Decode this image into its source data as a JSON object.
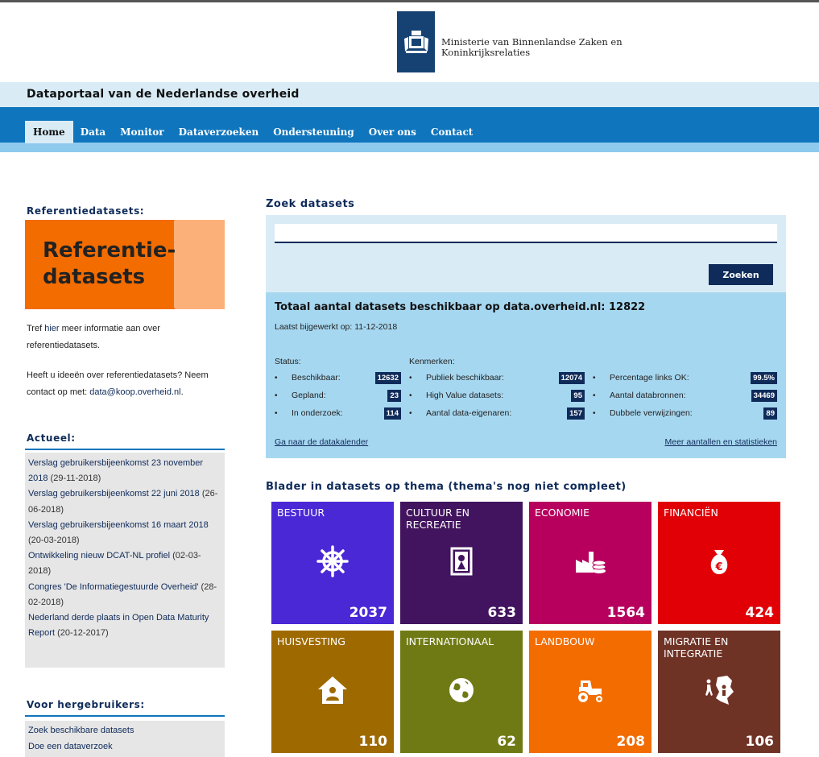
{
  "header": {
    "ministry_line1": "Ministerie van Binnenlandse Zaken en",
    "ministry_line2": "Koninkrijksrelaties",
    "portal_title": "Dataportaal van de Nederlandse overheid"
  },
  "nav": {
    "items": [
      {
        "label": "Home",
        "active": true
      },
      {
        "label": "Data"
      },
      {
        "label": "Monitor"
      },
      {
        "label": "Dataverzoeken"
      },
      {
        "label": "Ondersteuning"
      },
      {
        "label": "Over ons"
      },
      {
        "label": "Contact"
      }
    ]
  },
  "sidebar": {
    "ref_heading": "Referentiedatasets:",
    "ref_banner_line1": "Referentie-",
    "ref_banner_line2": "datasets",
    "ref_text_prefix": "Tref ",
    "ref_text_link": "hier",
    "ref_text_suffix": " meer informatie aan over referentiedatasets.",
    "ideas_text": "Heeft u ideeën over referentiedatasets? Neem contact op met: ",
    "ideas_email": "data@koop.overheid.nl",
    "ideas_end": ".",
    "actueel_heading": "Actueel:",
    "actueel_items": [
      {
        "link": "Verslag gebruikersbijeenkomst 23 november 2018",
        "date": " (29-11-2018)"
      },
      {
        "link": "Verslag gebruikersbijeenkomst 22 juni 2018",
        "date": " (26-06-2018)"
      },
      {
        "link": "Verslag gebruikersbijeenkomst 16 maart 2018",
        "date": " (20-03-2018)"
      },
      {
        "link": "Ontwikkeling nieuw DCAT-NL profiel",
        "date": " (02-03-2018)"
      },
      {
        "link": "Congres 'De Informatiegestuurde Overheid'",
        "date": " (28-02-2018)"
      },
      {
        "link": "Nederland derde plaats in Open Data Maturity Report",
        "date": " (20-12-2017)"
      }
    ],
    "hergebruikers_heading": "Voor hergebruikers:",
    "hergebruikers_items": [
      "Zoek beschikbare datasets",
      "Doe een dataverzoek"
    ]
  },
  "search": {
    "title": "Zoek datasets",
    "input_value": "",
    "button_label": "Zoeken"
  },
  "stats": {
    "title": "Totaal aantal datasets beschikbaar op data.overheid.nl: 12822",
    "updated": "Laatst bijgewerkt op: 11-12-2018",
    "status_head": "Status:",
    "kenmerken_head": "Kenmerken:",
    "status": [
      {
        "label": "Beschikbaar:",
        "value": "12632"
      },
      {
        "label": "Gepland:",
        "value": "23"
      },
      {
        "label": "In onderzoek:",
        "value": "114"
      }
    ],
    "kenmerken": [
      {
        "label": "Publiek beschikbaar:",
        "value": "12074"
      },
      {
        "label": "High Value datasets:",
        "value": "95"
      },
      {
        "label": "Aantal data-eigenaren:",
        "value": "157"
      }
    ],
    "extra": [
      {
        "label": "Percentage links OK:",
        "value": "99.5%"
      },
      {
        "label": "Aantal databronnen:",
        "value": "34469"
      },
      {
        "label": "Dubbele verwijzingen:",
        "value": "89"
      }
    ],
    "link_left": "Ga naar de datakalender",
    "link_right": "Meer aantallen en statistieken"
  },
  "themes": {
    "title": "Blader in datasets op thema (thema's nog niet compleet)",
    "tiles": [
      {
        "name": "BESTUUR",
        "count": "2037",
        "color": "#4a28d6",
        "icon": "helm-icon"
      },
      {
        "name": "CULTUUR EN RECREATIE",
        "count": "633",
        "color": "#42145f",
        "icon": "painting-icon"
      },
      {
        "name": "ECONOMIE",
        "count": "1564",
        "color": "#b7005e",
        "icon": "factory-coins-icon"
      },
      {
        "name": "FINANCIËN",
        "count": "424",
        "color": "#e10005",
        "icon": "money-bag-icon"
      },
      {
        "name": "HUISVESTING",
        "count": "110",
        "color": "#9e6a00",
        "icon": "house-person-icon"
      },
      {
        "name": "INTERNATIONAAL",
        "count": "62",
        "color": "#6f7a14",
        "icon": "globe-icon"
      },
      {
        "name": "LANDBOUW",
        "count": "208",
        "color": "#f36c00",
        "icon": "tractor-icon"
      },
      {
        "name": "MIGRATIE EN INTEGRATIE",
        "count": "106",
        "color": "#6f3326",
        "icon": "migration-icon"
      }
    ]
  }
}
